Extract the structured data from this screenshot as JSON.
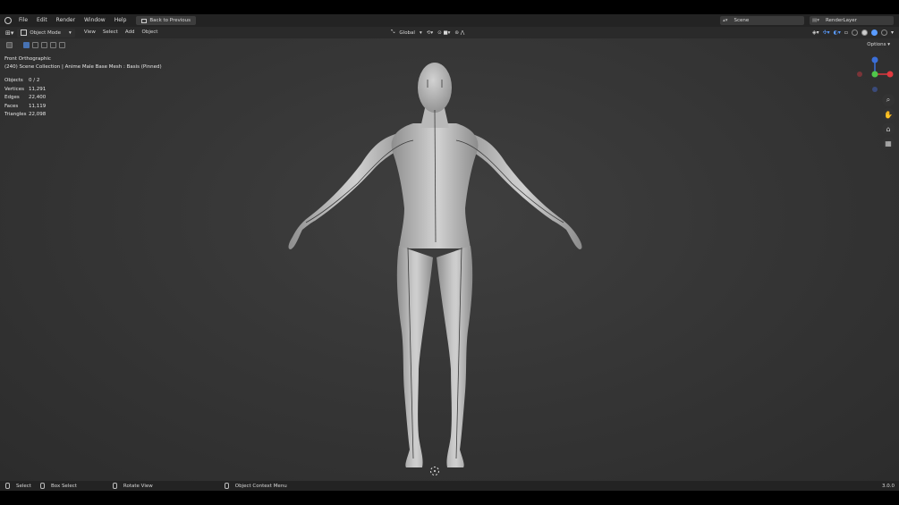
{
  "menu": [
    "File",
    "Edit",
    "Render",
    "Window",
    "Help"
  ],
  "back_button": "Back to Previous",
  "scene": "Scene",
  "render_layer": "RenderLayer",
  "header": {
    "mode": "Object Mode",
    "menus": [
      "View",
      "Select",
      "Add",
      "Object"
    ],
    "transform": "Global"
  },
  "viewport": {
    "view_name": "Front Orthographic",
    "collection": "(240) Scene Collection | Anime Male Base Mesh : Basis (Pinned)",
    "options": "Options",
    "stats": [
      {
        "label": "Objects",
        "value": "0 / 2"
      },
      {
        "label": "Vertices",
        "value": "11,291"
      },
      {
        "label": "Edges",
        "value": "22,400"
      },
      {
        "label": "Faces",
        "value": "11,119"
      },
      {
        "label": "Triangles",
        "value": "22,098"
      }
    ]
  },
  "status": {
    "select": "Select",
    "box_select": "Box Select",
    "rotate_view": "Rotate View",
    "context_menu": "Object Context Menu",
    "version": "3.0.0"
  },
  "gizmo_colors": {
    "x": "#e0393f",
    "y": "#50c64a",
    "z": "#3b6fd9"
  }
}
